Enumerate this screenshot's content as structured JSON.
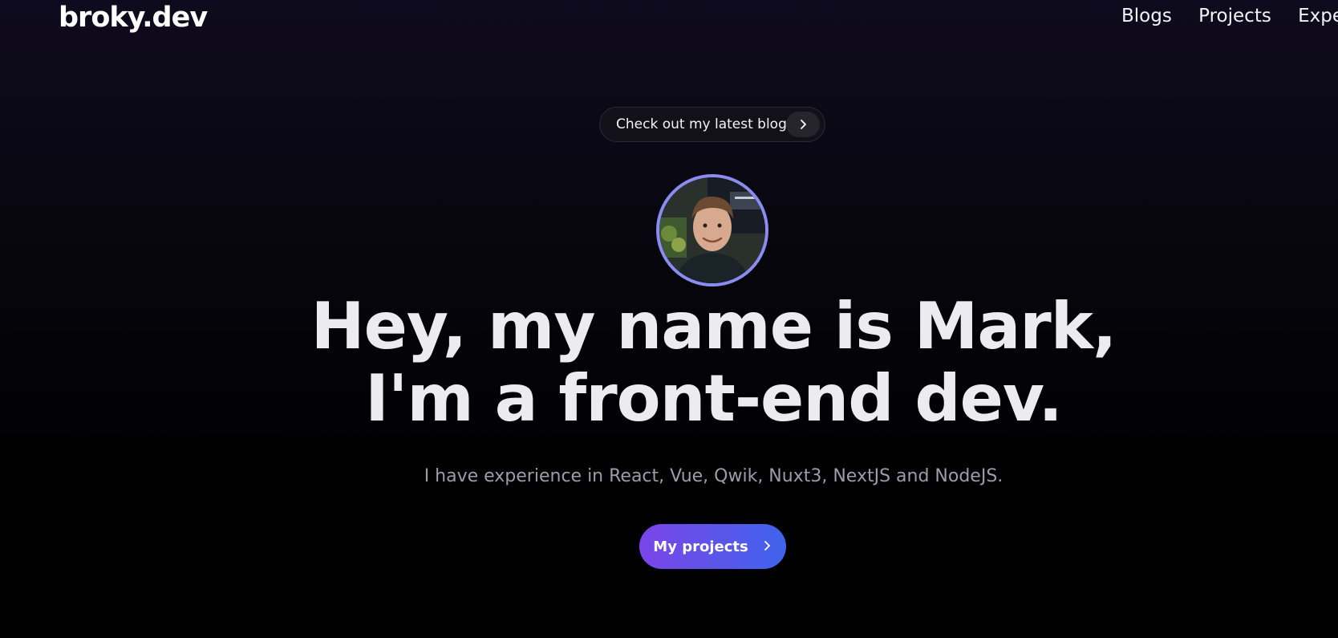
{
  "nav": {
    "brand": "broky.dev",
    "links": [
      "Blogs",
      "Projects",
      "Exper"
    ]
  },
  "announcement": {
    "label": "Check out my latest blogs.",
    "icon": "chevron-right-icon"
  },
  "hero": {
    "avatar_alt": "profile-photo",
    "headline_line1": "Hey, my name is Mark,",
    "headline_line2": "I'm a front-end dev.",
    "subtitle": "I have experience in React, Vue, Qwik, Nuxt3, NextJS and NodeJS."
  },
  "cta": {
    "label": "My projects",
    "icon": "chevron-right-icon"
  },
  "colors": {
    "background_top": "#0f0b1e",
    "background_bottom": "#000000",
    "avatar_ring": "#8a8cf2",
    "cta_gradient_start": "#7b45e8",
    "cta_gradient_end": "#3f63ec"
  }
}
